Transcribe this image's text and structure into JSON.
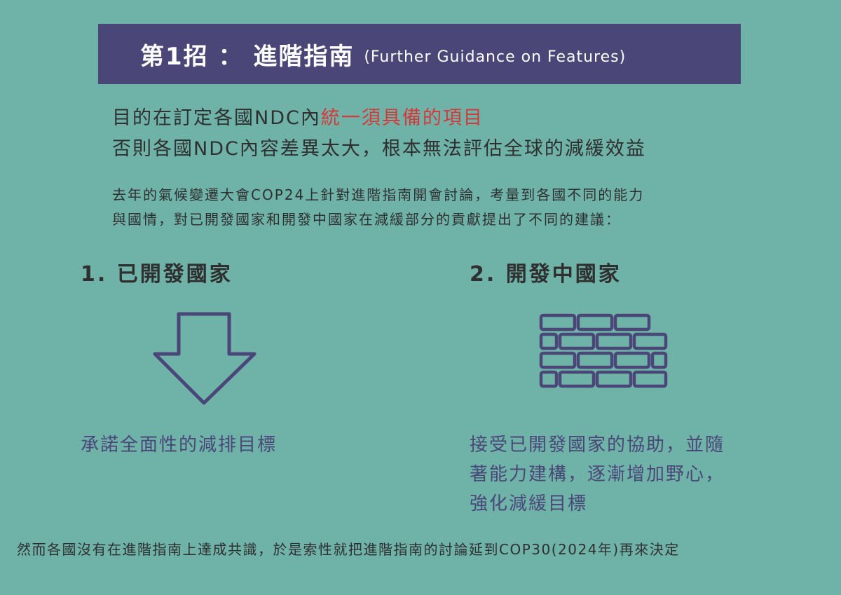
{
  "title": {
    "main": "第1招 ： 進階指南",
    "sub": "(Further Guidance on Features)"
  },
  "intro": {
    "line1_prefix": "目的在訂定各國NDC內",
    "line1_highlight": "統一須具備的項目",
    "line2": "否則各國NDC內容差異太大，根本無法評估全球的減緩效益",
    "highlight_color": "#d6383a"
  },
  "body": {
    "line1": "去年的氣候變遷大會COP24上針對進階指南開會討論，考量到各國不同的能力",
    "line2": "與國情，對已開發國家和開發中國家在減緩部分的貢獻提出了不同的建議："
  },
  "developed": {
    "heading": "1. 已開發國家",
    "icon": "down-arrow-icon",
    "text": "承諾全面性的減排目標"
  },
  "developing": {
    "heading": "2. 開發中國家",
    "icon": "brick-wall-icon",
    "line1": "接受已開發國家的協助，並隨",
    "line2": "著能力建構，逐漸增加野心，",
    "line3": "強化減緩目標"
  },
  "footer": "然而各國沒有在進階指南上達成共識，於是索性就把進階指南的討論延到COP30(2024年)再來決定",
  "colors": {
    "background": "#6fb3a8",
    "accent": "#4a4778",
    "text": "#2f2f2f"
  }
}
